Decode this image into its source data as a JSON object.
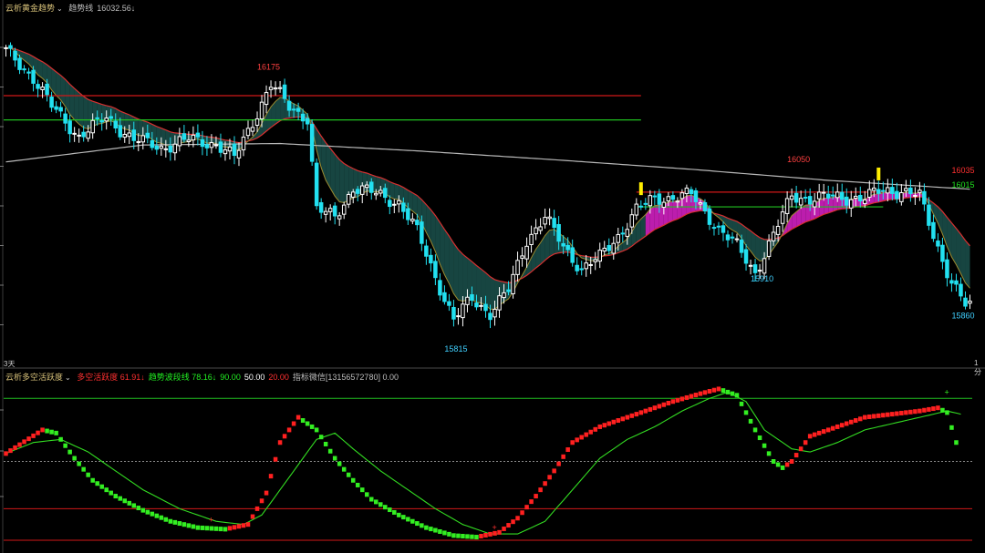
{
  "main_header": {
    "indicator_name": "云析黄金趋势",
    "trend_label": "趋势线",
    "trend_value": "16032.56",
    "trend_arrow": "↓"
  },
  "oscillator_header": {
    "indicator_name": "云析多空活跃度",
    "items": [
      {
        "label": "多空活跃度",
        "value": "61.91",
        "arrow": "↓",
        "color": "#ff3030"
      },
      {
        "label": "趋势波段线",
        "value": "78.16",
        "arrow": "↓",
        "color": "#22ee22"
      },
      {
        "label": "",
        "value": "90.00",
        "arrow": "",
        "color": "#22ee22"
      },
      {
        "label": "",
        "value": "50.00",
        "arrow": "",
        "color": "#ffffff"
      },
      {
        "label": "",
        "value": "20.00",
        "arrow": "",
        "color": "#ff3030"
      },
      {
        "label": "指标微信[13156572780]",
        "value": "0.00",
        "arrow": "",
        "color": "#bdbdbd"
      }
    ]
  },
  "axis": {
    "left_bottom_label": "3天",
    "right_bottom_label": "1分"
  },
  "colors": {
    "background": "#000000",
    "candle_up": "#ffffff",
    "candle_down": "#22e0f0",
    "resistance": "#d01818",
    "support": "#20c020",
    "long_ma": "#b8b8b8",
    "cloud_bear": "#1a4d48",
    "cloud_bull": "#d020c0",
    "osc_up": "#ff2020",
    "osc_down": "#33ee22",
    "signal": "#33dd22"
  },
  "chart_data": [
    {
      "type": "candlestick",
      "title": "云析黄金趋势",
      "ylim": [
        15790,
        16260
      ],
      "annotations": [
        {
          "text": "16175",
          "x": 57,
          "y": 16175,
          "color": "#ff4040"
        },
        {
          "text": "15815",
          "x": 98,
          "y": 15815,
          "color": "#40d0ff"
        },
        {
          "text": "16050",
          "x": 173,
          "y": 16050,
          "color": "#ff4040"
        },
        {
          "text": "15910",
          "x": 165,
          "y": 15910,
          "color": "#40d0ff"
        },
        {
          "text": "16035",
          "x": 209,
          "y": 16035,
          "color": "#ff3030"
        },
        {
          "text": "16015",
          "x": 209,
          "y": 16015,
          "color": "#20e020"
        },
        {
          "text": "15860",
          "x": 209,
          "y": 15860,
          "color": "#40d0ff"
        }
      ],
      "hlines": [
        {
          "value": 16145,
          "x_end": 139,
          "color": "#d01818"
        },
        {
          "value": 16112,
          "x_end": 139,
          "color": "#20c020"
        },
        {
          "value": 16014,
          "x_start": 138,
          "x_end": 192,
          "color": "#d01818"
        },
        {
          "value": 15994,
          "x_start": 138,
          "x_end": 192,
          "color": "#20c020"
        }
      ],
      "path_points": [
        [
          0,
          16205
        ],
        [
          6,
          16170
        ],
        [
          10,
          16130
        ],
        [
          16,
          16090
        ],
        [
          22,
          16115
        ],
        [
          28,
          16085
        ],
        [
          34,
          16075
        ],
        [
          40,
          16085
        ],
        [
          46,
          16080
        ],
        [
          50,
          16060
        ],
        [
          54,
          16110
        ],
        [
          58,
          16160
        ],
        [
          62,
          16130
        ],
        [
          66,
          16115
        ],
        [
          68,
          15990
        ],
        [
          72,
          15980
        ],
        [
          76,
          16020
        ],
        [
          82,
          16010
        ],
        [
          86,
          16000
        ],
        [
          90,
          15960
        ],
        [
          94,
          15900
        ],
        [
          98,
          15840
        ],
        [
          102,
          15870
        ],
        [
          106,
          15850
        ],
        [
          110,
          15880
        ],
        [
          114,
          15950
        ],
        [
          118,
          15980
        ],
        [
          122,
          15940
        ],
        [
          126,
          15910
        ],
        [
          130,
          15925
        ],
        [
          134,
          15955
        ],
        [
          138,
          15990
        ],
        [
          142,
          16005
        ],
        [
          150,
          16010
        ],
        [
          156,
          15965
        ],
        [
          160,
          15940
        ],
        [
          164,
          15905
        ],
        [
          168,
          15955
        ],
        [
          172,
          16010
        ],
        [
          176,
          16005
        ],
        [
          182,
          16008
        ],
        [
          188,
          16005
        ],
        [
          192,
          16018
        ],
        [
          196,
          16015
        ],
        [
          200,
          16008
        ],
        [
          204,
          15940
        ],
        [
          207,
          15890
        ],
        [
          210,
          15860
        ]
      ],
      "long_ma_points": [
        [
          0,
          16055
        ],
        [
          30,
          16078
        ],
        [
          60,
          16080
        ],
        [
          90,
          16070
        ],
        [
          120,
          16058
        ],
        [
          150,
          16045
        ],
        [
          180,
          16030
        ],
        [
          211,
          16018
        ]
      ]
    },
    {
      "type": "line",
      "title": "云析多空活跃度",
      "ylim": [
        0,
        100
      ],
      "reference_lines": [
        90,
        50,
        20,
        0
      ],
      "series": [
        {
          "name": "多空活跃度",
          "points": [
            [
              0,
              55
            ],
            [
              8,
              70
            ],
            [
              11,
              68
            ],
            [
              15,
              52
            ],
            [
              19,
              38
            ],
            [
              24,
              28
            ],
            [
              30,
              19
            ],
            [
              36,
              12
            ],
            [
              42,
              8
            ],
            [
              48,
              7
            ],
            [
              53,
              10
            ],
            [
              57,
              30
            ],
            [
              60,
              62
            ],
            [
              64,
              78
            ],
            [
              68,
              70
            ],
            [
              72,
              52
            ],
            [
              76,
              38
            ],
            [
              80,
              26
            ],
            [
              86,
              16
            ],
            [
              92,
              8
            ],
            [
              98,
              3
            ],
            [
              103,
              2
            ],
            [
              108,
              5
            ],
            [
              112,
              14
            ],
            [
              116,
              28
            ],
            [
              120,
              44
            ],
            [
              124,
              62
            ],
            [
              130,
              72
            ],
            [
              138,
              80
            ],
            [
              146,
              88
            ],
            [
              152,
              93
            ],
            [
              156,
              96
            ],
            [
              160,
              92
            ],
            [
              164,
              70
            ],
            [
              168,
              50
            ],
            [
              170,
              46
            ],
            [
              172,
              50
            ],
            [
              176,
              66
            ],
            [
              182,
              72
            ],
            [
              188,
              78
            ],
            [
              194,
              80
            ],
            [
              200,
              82
            ],
            [
              204,
              84
            ],
            [
              206,
              81
            ],
            [
              208,
              62
            ]
          ]
        },
        {
          "name": "趋势波段线",
          "points": [
            [
              0,
              55
            ],
            [
              6,
              62
            ],
            [
              12,
              64
            ],
            [
              18,
              56
            ],
            [
              24,
              44
            ],
            [
              30,
              32
            ],
            [
              38,
              20
            ],
            [
              46,
              12
            ],
            [
              52,
              10
            ],
            [
              56,
              16
            ],
            [
              62,
              40
            ],
            [
              68,
              64
            ],
            [
              72,
              68
            ],
            [
              76,
              58
            ],
            [
              82,
              44
            ],
            [
              88,
              32
            ],
            [
              94,
              20
            ],
            [
              100,
              10
            ],
            [
              106,
              4
            ],
            [
              112,
              4
            ],
            [
              118,
              12
            ],
            [
              124,
              32
            ],
            [
              130,
              52
            ],
            [
              136,
              64
            ],
            [
              142,
              72
            ],
            [
              148,
              82
            ],
            [
              154,
              90
            ],
            [
              158,
              94
            ],
            [
              162,
              88
            ],
            [
              166,
              70
            ],
            [
              172,
              58
            ],
            [
              176,
              56
            ],
            [
              182,
              62
            ],
            [
              188,
              70
            ],
            [
              194,
              74
            ],
            [
              200,
              78
            ],
            [
              206,
              82
            ],
            [
              209,
              80
            ]
          ]
        }
      ]
    }
  ]
}
